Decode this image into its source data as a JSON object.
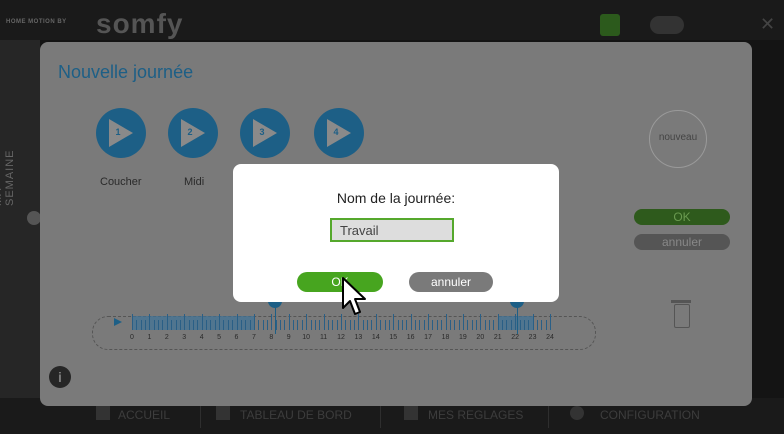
{
  "header": {
    "tagline": "HOME MOTION BY",
    "brand": "somfy"
  },
  "side_tab": {
    "label": "MA SEMAINE"
  },
  "panel": {
    "title": "Nouvelle journée",
    "steps": [
      {
        "num": "1",
        "label": "Coucher"
      },
      {
        "num": "2",
        "label": "Midi"
      },
      {
        "num": "3",
        "label": ""
      },
      {
        "num": "4",
        "label": ""
      }
    ],
    "new_label": "nouveau",
    "ok_label": "OK",
    "cancel_label": "annuler",
    "info_icon": "i"
  },
  "timeline": {
    "hours": [
      "0",
      "1",
      "2",
      "3",
      "4",
      "5",
      "6",
      "7",
      "8",
      "9",
      "10",
      "11",
      "12",
      "13",
      "14",
      "15",
      "16",
      "17",
      "18",
      "19",
      "20",
      "21",
      "22",
      "23",
      "24"
    ]
  },
  "dialog": {
    "title": "Nom de la journée:",
    "input_value": "Travail",
    "ok_label": "OK",
    "cancel_label": "annuler"
  },
  "bottom_nav": {
    "items": [
      {
        "label": "ACCUEIL"
      },
      {
        "label": "TABLEAU DE BORD"
      },
      {
        "label": "MES REGLAGES"
      },
      {
        "label": "CONFIGURATION"
      }
    ]
  },
  "colors": {
    "accent_blue": "#1d5f86",
    "accent_green": "#47a51f",
    "cancel_grey": "#7a7a7a"
  }
}
